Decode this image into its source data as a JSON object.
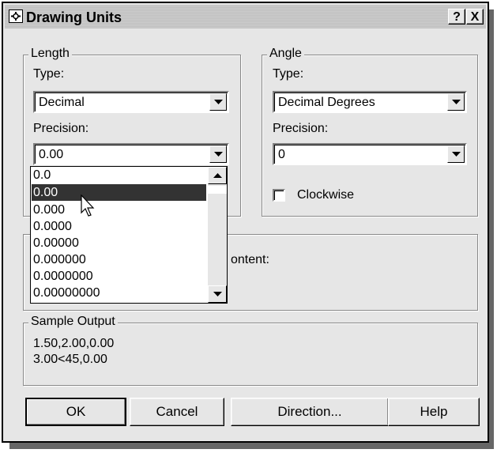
{
  "window": {
    "title": "Drawing Units",
    "help_btn": "?",
    "close_btn": "X"
  },
  "length": {
    "group_label": "Length",
    "type_label": "Type:",
    "type_value": "Decimal",
    "precision_label": "Precision:",
    "precision_value": "0.00",
    "precision_options": [
      "0.0",
      "0.00",
      "0.000",
      "0.0000",
      "0.00000",
      "0.000000",
      "0.0000000",
      "0.00000000"
    ],
    "selected_index": 1
  },
  "angle": {
    "group_label": "Angle",
    "type_label": "Type:",
    "type_value": "Decimal Degrees",
    "precision_label": "Precision:",
    "precision_value": "0",
    "clockwise_label": "Clockwise",
    "clockwise_checked": false
  },
  "drag_drop": {
    "partial_label": "ontent:"
  },
  "sample_output": {
    "group_label": "Sample Output",
    "line1": "1.50,2.00,0.00",
    "line2": "3.00<45,0.00"
  },
  "buttons": {
    "ok": "OK",
    "cancel": "Cancel",
    "direction": "Direction...",
    "help": "Help"
  },
  "icons": {
    "title": "settings-icon",
    "dropdown": "chevron-down-icon",
    "cursor": "mouse-pointer-icon"
  }
}
